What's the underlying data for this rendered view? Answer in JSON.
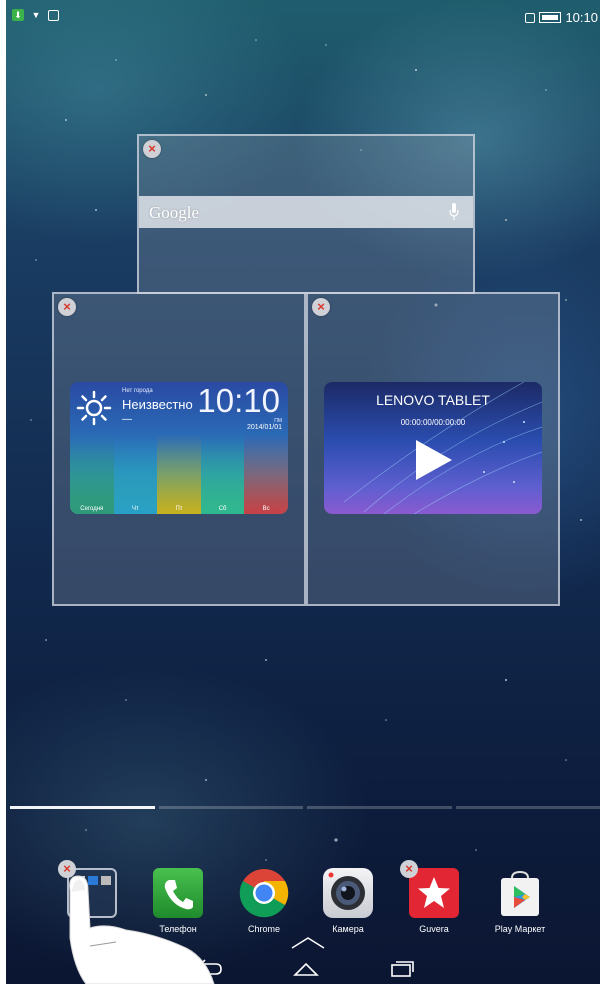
{
  "status_bar": {
    "time": "10:10"
  },
  "widgets": {
    "google_search": {
      "logo_text": "Google"
    },
    "weather": {
      "small_label": "Нет города",
      "city": "Неизвестно",
      "temp": "—",
      "time": "10:10",
      "ampm": "ПМ",
      "date": "2014/01/01",
      "days": [
        "Сегодня",
        "Чт",
        "Пт",
        "Сб",
        "Вс"
      ],
      "day_colors": [
        "#2f9a7a",
        "#28a0c8",
        "#c8b020",
        "#2fb890",
        "#c84048"
      ]
    },
    "video": {
      "title": "LENOVO TABLET",
      "time": "00:00:00/00:00:00"
    }
  },
  "pager": {
    "pages": 4,
    "active_index": 0
  },
  "dock": {
    "items": [
      {
        "label": "",
        "icon": "folder-icon"
      },
      {
        "label": "Телефон",
        "icon": "phone-icon"
      },
      {
        "label": "Chrome",
        "icon": "chrome-icon"
      },
      {
        "label": "Камера",
        "icon": "camera-icon"
      },
      {
        "label": "Guvera",
        "icon": "guvera-icon"
      },
      {
        "label": "Play Маркет",
        "icon": "play-store-icon"
      }
    ]
  },
  "colors": {
    "close_x": "#d8362a",
    "phone_green": "#2fa83a",
    "guvera_red": "#e32634"
  }
}
